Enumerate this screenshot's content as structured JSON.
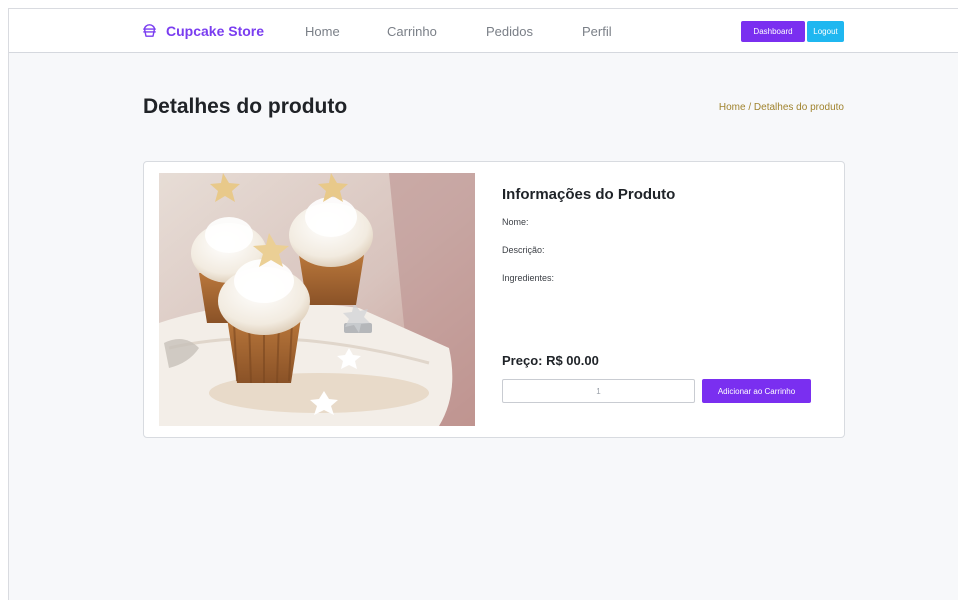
{
  "navbar": {
    "brand": "Cupcake Store",
    "links": [
      "Home",
      "Carrinho",
      "Pedidos",
      "Perfil"
    ],
    "dashboard_label": "Dashboard",
    "logout_label": "Logout",
    "accent_color": "#7a2ff0",
    "logout_color": "#1fb7f0"
  },
  "page": {
    "title": "Detalhes do produto",
    "breadcrumb_home": "Home",
    "breadcrumb_separator": "/",
    "breadcrumb_current": "Detalhes do produto"
  },
  "product": {
    "image_icon": "cupcake-photo",
    "info_title": "Informações do Produto",
    "name_label": "Nome:",
    "description_label": "Descrição:",
    "ingredients_label": "Ingredientes:",
    "price_label": "Preço: R$ 00.00",
    "quantity_value": "1",
    "add_to_cart_label": "Adicionar ao Carrinho"
  }
}
